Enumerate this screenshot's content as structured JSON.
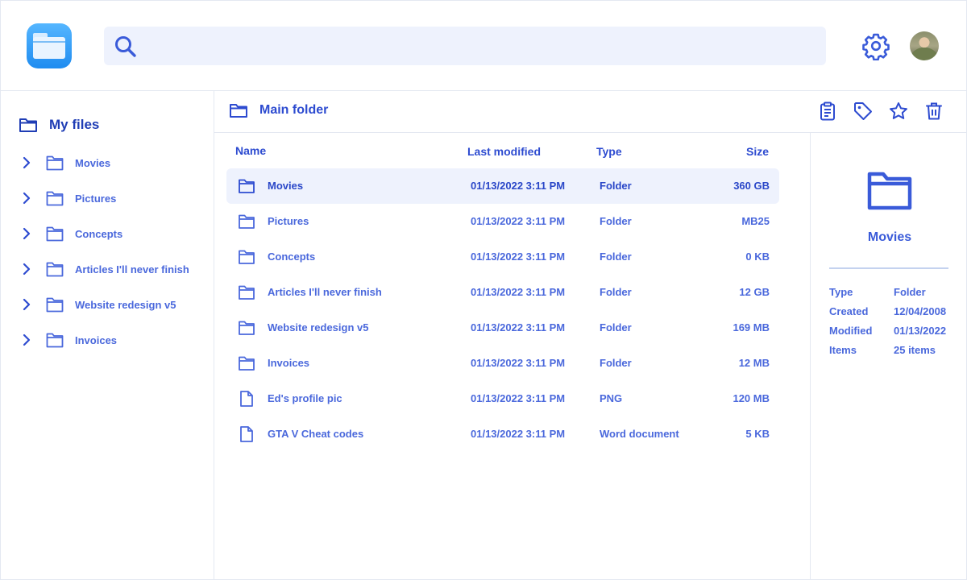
{
  "search": {
    "placeholder": "",
    "icon": "search-icon"
  },
  "header": {
    "settings_icon": "gear-icon",
    "avatar_icon": "user-avatar"
  },
  "sidebar": {
    "title": "My files",
    "items": [
      {
        "label": "Movies"
      },
      {
        "label": "Pictures"
      },
      {
        "label": "Concepts"
      },
      {
        "label": "Articles I'll never finish"
      },
      {
        "label": "Website redesign v5"
      },
      {
        "label": "Invoices"
      }
    ]
  },
  "toolbar": {
    "title": "Main folder",
    "actions": [
      "clipboard-icon",
      "tag-icon",
      "star-icon",
      "trash-icon"
    ]
  },
  "table": {
    "headers": {
      "name": "Name",
      "modified": "Last modified",
      "type": "Type",
      "size": "Size"
    },
    "rows": [
      {
        "name": "Movies",
        "modified": "01/13/2022 3:11 PM",
        "type": "Folder",
        "size": "360 GB",
        "icon": "folder-icon",
        "selected": true
      },
      {
        "name": "Pictures",
        "modified": "01/13/2022 3:11 PM",
        "type": "Folder",
        "size": "MB25",
        "icon": "folder-icon"
      },
      {
        "name": "Concepts",
        "modified": "01/13/2022 3:11 PM",
        "type": "Folder",
        "size": "0 KB",
        "icon": "folder-icon"
      },
      {
        "name": "Articles I'll never finish",
        "modified": "01/13/2022 3:11 PM",
        "type": "Folder",
        "size": "12 GB",
        "icon": "folder-icon"
      },
      {
        "name": "Website redesign v5",
        "modified": "01/13/2022 3:11 PM",
        "type": "Folder",
        "size": "169 MB",
        "icon": "folder-icon"
      },
      {
        "name": "Invoices",
        "modified": "01/13/2022 3:11 PM",
        "type": "Folder",
        "size": "12 MB",
        "icon": "folder-icon"
      },
      {
        "name": "Ed's profile pic",
        "modified": "01/13/2022 3:11 PM",
        "type": "PNG",
        "size": "120 MB",
        "icon": "file-icon"
      },
      {
        "name": "GTA V Cheat codes",
        "modified": "01/13/2022 3:11 PM",
        "type": "Word document",
        "size": "5 KB",
        "icon": "file-icon"
      }
    ]
  },
  "details": {
    "name": "Movies",
    "fields": [
      {
        "key": "Type",
        "value": "Folder"
      },
      {
        "key": "Created",
        "value": "12/04/2008"
      },
      {
        "key": "Modified",
        "value": "01/13/2022"
      },
      {
        "key": "Items",
        "value": "25 items"
      }
    ]
  },
  "colors": {
    "accent": "#3a5bd9",
    "accent_dark": "#1f3db5",
    "search_bg": "#eef2fd",
    "selected_row_bg": "#eef2fd",
    "border": "#e4e8f1"
  }
}
